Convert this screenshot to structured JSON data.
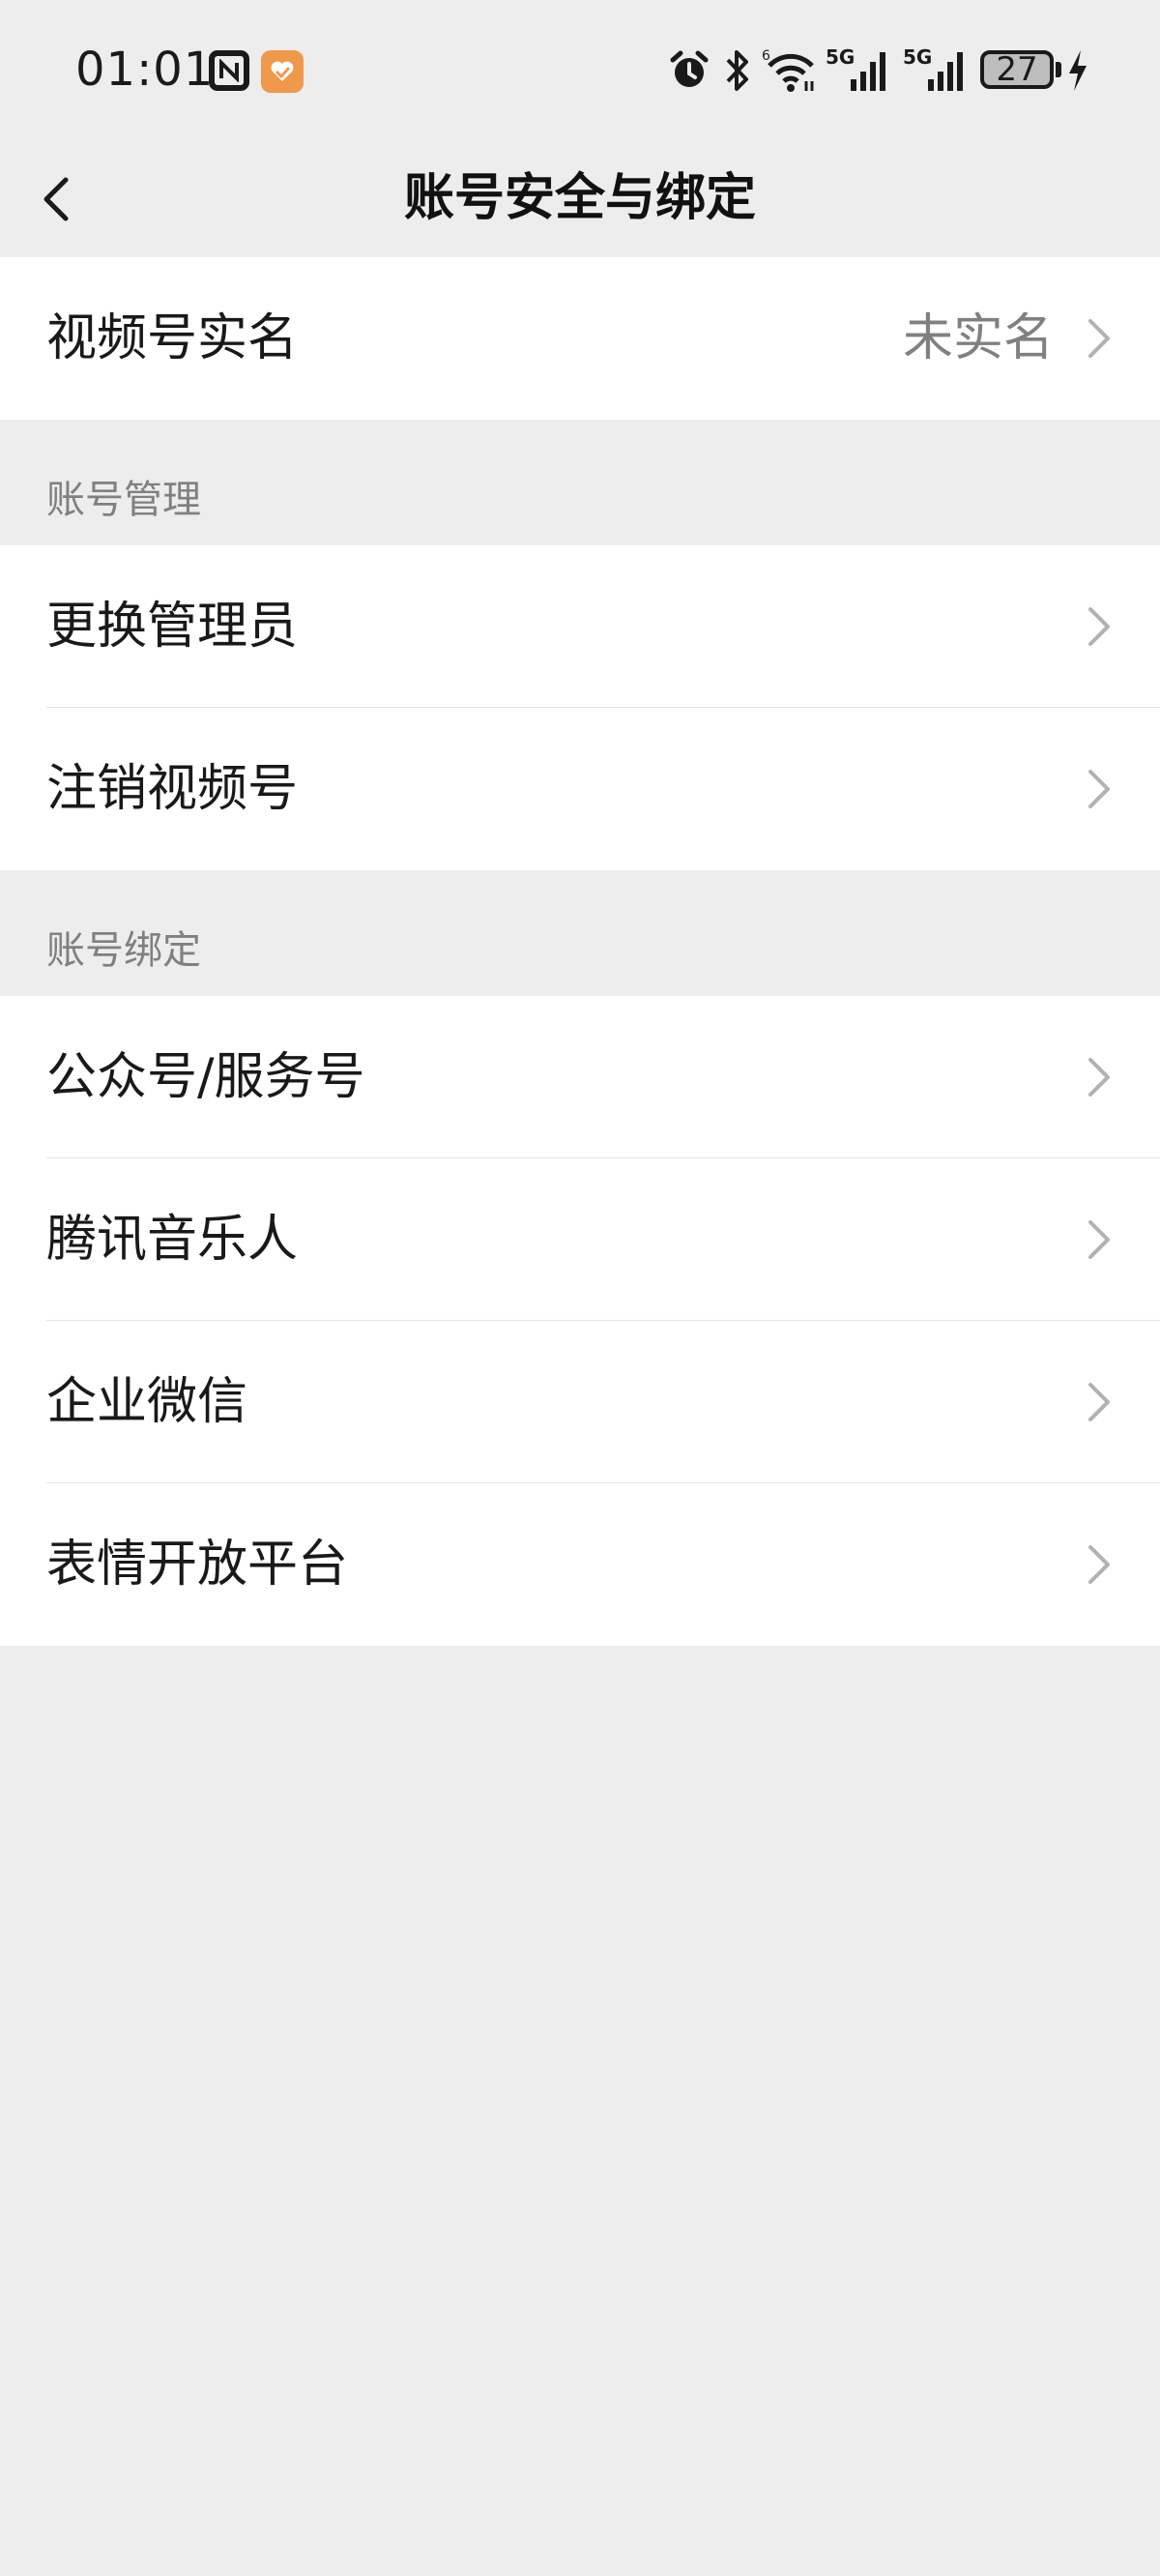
{
  "status_bar": {
    "time": "01:01",
    "battery": "27",
    "icons": [
      "nfc-icon",
      "health-app-icon",
      "alarm-icon",
      "bluetooth-icon",
      "wifi-icon",
      "signal-5g-icon",
      "signal-5g-icon",
      "battery-icon",
      "charging-icon"
    ]
  },
  "nav": {
    "title": "账号安全与绑定",
    "back_icon": "chevron-left-icon"
  },
  "real_name": {
    "label": "视频号实名",
    "value": "未实名"
  },
  "account_management": {
    "header": "账号管理",
    "items": [
      {
        "label": "更换管理员"
      },
      {
        "label": "注销视频号"
      }
    ]
  },
  "account_binding": {
    "header": "账号绑定",
    "items": [
      {
        "label": "公众号/服务号"
      },
      {
        "label": "腾讯音乐人"
      },
      {
        "label": "企业微信"
      },
      {
        "label": "表情开放平台"
      }
    ]
  },
  "colors": {
    "background": "#ededed",
    "card": "#ffffff",
    "secondary_text": "#808080",
    "health_icon": "#f0994a"
  }
}
